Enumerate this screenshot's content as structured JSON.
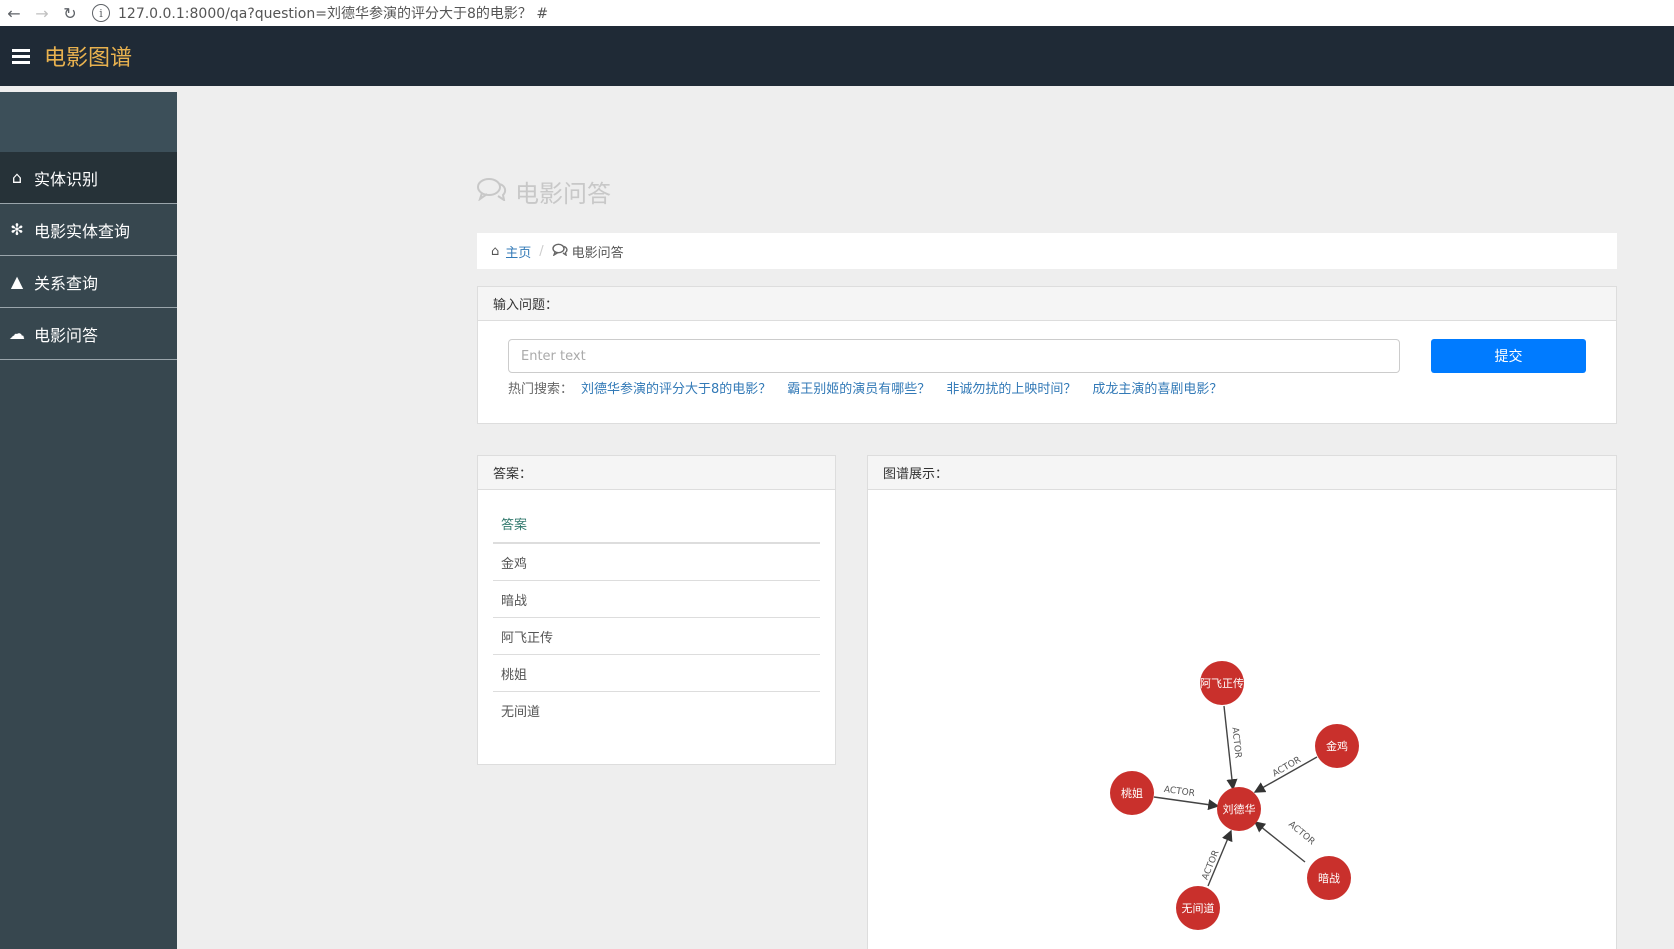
{
  "browser": {
    "back_icon": "←",
    "forward_icon": "→",
    "reload_icon": "↻",
    "info_icon": "i",
    "url": "127.0.0.1:8000/qa?question=刘德华参演的评分大于8的电影？ #"
  },
  "header": {
    "brand": "电影图谱"
  },
  "sidebar": {
    "items": [
      {
        "label": "实体识别",
        "icon": "⌂"
      },
      {
        "label": "电影实体查询",
        "icon": "✻"
      },
      {
        "label": "关系查询",
        "icon": "▲"
      },
      {
        "label": "电影问答",
        "icon": "☁"
      }
    ]
  },
  "page": {
    "title": "电影问答",
    "title_icon": "💬"
  },
  "breadcrumb": {
    "home_icon": "⌂",
    "home": "主页",
    "separator": "/",
    "current_icon": "💬",
    "current": "电影问答"
  },
  "question": {
    "heading": "输入问题：",
    "placeholder": "Enter text",
    "submit": "提交",
    "hot_label": "热门搜索：",
    "hot_links": [
      "刘德华参演的评分大于8的电影？",
      "霸王别姬的演员有哪些？",
      "非诚勿扰的上映时间？",
      "成龙主演的喜剧电影？"
    ]
  },
  "answer": {
    "heading": "答案：",
    "column": "答案",
    "rows": [
      "金鸡",
      "暗战",
      "阿飞正传",
      "桃姐",
      "无间道"
    ]
  },
  "graph": {
    "heading": "图谱展示：",
    "node_color": "#c9302c",
    "center": "刘德华",
    "relation": "ACTOR",
    "nodes": [
      "阿飞正传",
      "金鸡",
      "桃姐",
      "暗战",
      "无间道"
    ]
  }
}
